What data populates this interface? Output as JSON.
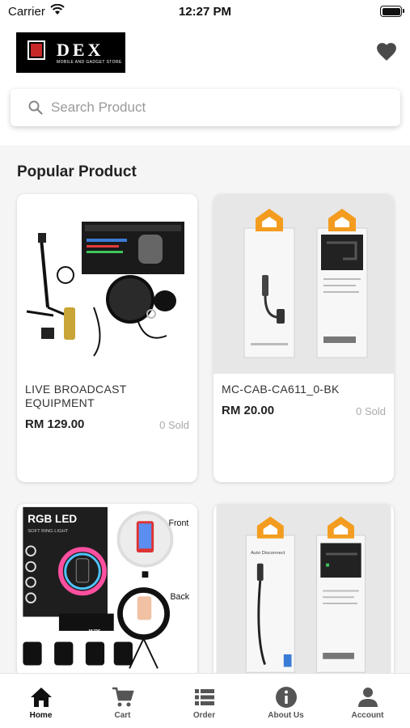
{
  "status_bar": {
    "carrier": "Carrier",
    "time": "12:27 PM"
  },
  "header": {
    "logo_name": "DEX",
    "logo_tagline": "MOBILE AND GADGET STORE",
    "wishlist_icon": "heart-icon"
  },
  "search": {
    "placeholder": "Search Product"
  },
  "section": {
    "title": "Popular Product"
  },
  "products": [
    {
      "title": "LIVE BROADCAST EQUIPMENT",
      "price": "RM 129.00",
      "sold": "0 Sold"
    },
    {
      "title": "MC-CAB-CA611_0-BK",
      "price": "RM 20.00",
      "sold": "0 Sold"
    },
    {
      "image_text": {
        "brand": "RGB LED",
        "subtitle": "SOFT RING LIGHT",
        "model": "MJ26",
        "front": "Front",
        "back": "Back"
      }
    },
    {
      "image_text": {
        "title": "Auto Disconnect"
      }
    }
  ],
  "bottom_nav": [
    {
      "label": "Home",
      "icon": "home-icon",
      "active": true
    },
    {
      "label": "Cart",
      "icon": "cart-icon"
    },
    {
      "label": "Order",
      "icon": "list-icon"
    },
    {
      "label": "About Us",
      "icon": "info-icon"
    },
    {
      "label": "Account",
      "icon": "person-icon"
    }
  ],
  "colors": {
    "accent_orange": "#f39c1f",
    "logo_red": "#c62828",
    "icon_gray": "#555555"
  }
}
